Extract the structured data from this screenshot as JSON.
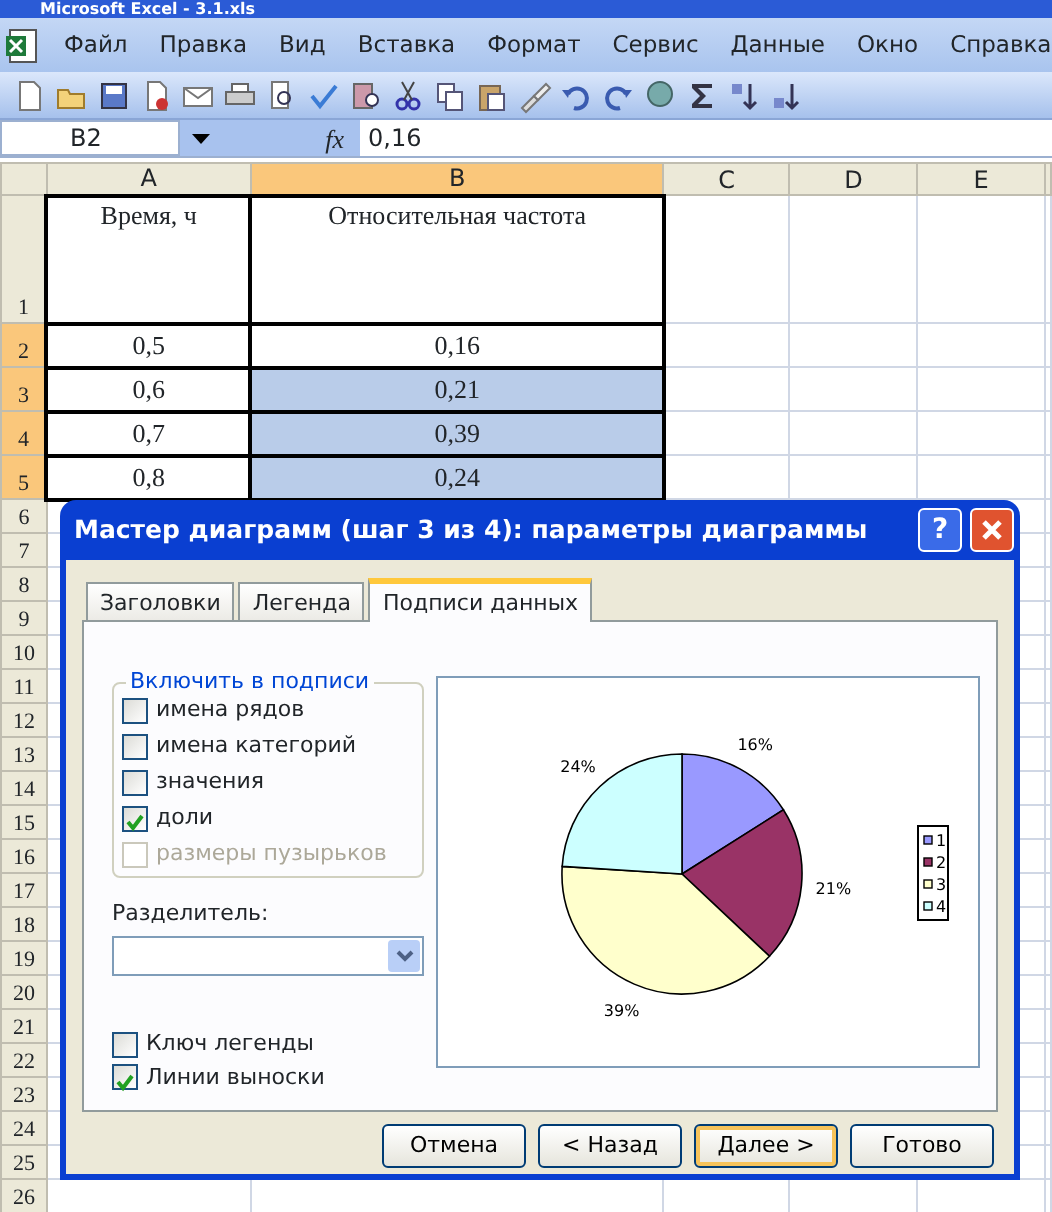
{
  "window": {
    "title": "Microsoft Excel - 3.1.xls"
  },
  "menu": [
    "Файл",
    "Правка",
    "Вид",
    "Вставка",
    "Формат",
    "Сервис",
    "Данные",
    "Окно",
    "Справка"
  ],
  "formula_bar": {
    "name_box": "B2",
    "fx": "fx",
    "value": "0,16"
  },
  "sheet": {
    "columns": [
      {
        "label": "A",
        "selected": false
      },
      {
        "label": "B",
        "selected": true
      },
      {
        "label": "C",
        "selected": false
      },
      {
        "label": "D",
        "selected": false
      },
      {
        "label": "E",
        "selected": false
      }
    ],
    "rows": [
      {
        "label": "1",
        "selected": false,
        "cells": [
          {
            "text": "Время, ч",
            "selected": false
          },
          {
            "text": "Относительная частота",
            "selected": false
          }
        ]
      },
      {
        "label": "2",
        "selected": true,
        "cells": [
          {
            "text": "0,5",
            "selected": false
          },
          {
            "text": "0,16",
            "selected": false
          }
        ]
      },
      {
        "label": "3",
        "selected": true,
        "cells": [
          {
            "text": "0,6",
            "selected": false
          },
          {
            "text": "0,21",
            "selected": true
          }
        ]
      },
      {
        "label": "4",
        "selected": true,
        "cells": [
          {
            "text": "0,7",
            "selected": false
          },
          {
            "text": "0,39",
            "selected": true
          }
        ]
      },
      {
        "label": "5",
        "selected": true,
        "cells": [
          {
            "text": "0,8",
            "selected": false
          },
          {
            "text": "0,24",
            "selected": true
          }
        ]
      },
      {
        "label": "6",
        "selected": false
      },
      {
        "label": "7",
        "selected": false
      },
      {
        "label": "8",
        "selected": false
      },
      {
        "label": "9",
        "selected": false
      },
      {
        "label": "10",
        "selected": false
      },
      {
        "label": "11",
        "selected": false
      },
      {
        "label": "12",
        "selected": false
      },
      {
        "label": "13",
        "selected": false
      },
      {
        "label": "14",
        "selected": false
      },
      {
        "label": "15",
        "selected": false
      },
      {
        "label": "16",
        "selected": false
      },
      {
        "label": "17",
        "selected": false
      },
      {
        "label": "18",
        "selected": false
      },
      {
        "label": "19",
        "selected": false
      },
      {
        "label": "20",
        "selected": false
      },
      {
        "label": "21",
        "selected": false
      },
      {
        "label": "22",
        "selected": false
      },
      {
        "label": "23",
        "selected": false
      },
      {
        "label": "24",
        "selected": false
      },
      {
        "label": "25",
        "selected": false
      },
      {
        "label": "26",
        "selected": false
      }
    ]
  },
  "dialog": {
    "title": "Мастер диаграмм (шаг 3 из 4): параметры диаграммы",
    "help": "?",
    "tabs": [
      {
        "label": "Заголовки",
        "selected": false
      },
      {
        "label": "Легенда",
        "selected": false
      },
      {
        "label": "Подписи данных",
        "selected": true
      }
    ],
    "group": {
      "title": "Включить в подписи",
      "options": [
        {
          "label": "имена рядов",
          "checked": false,
          "disabled": false
        },
        {
          "label": "имена категорий",
          "checked": false,
          "disabled": false
        },
        {
          "label": "значения",
          "checked": false,
          "disabled": false
        },
        {
          "label": "доли",
          "checked": true,
          "disabled": false
        },
        {
          "label": "размеры пузырьков",
          "checked": false,
          "disabled": true
        }
      ]
    },
    "separator": {
      "label": "Разделитель:"
    },
    "options": [
      {
        "label": "Ключ легенды",
        "checked": false
      },
      {
        "label": "Линии выноски",
        "checked": true
      }
    ],
    "preview": {
      "chart_data": {
        "type": "pie",
        "categories": [
          "1",
          "2",
          "3",
          "4"
        ],
        "values": [
          0.16,
          0.21,
          0.39,
          0.24
        ],
        "value_labels": [
          "16%",
          "21%",
          "39%",
          "24%"
        ],
        "legend": "right"
      }
    },
    "buttons": [
      {
        "label": "Отмена",
        "default": false
      },
      {
        "label": "< Назад",
        "default": false
      },
      {
        "label": "Далее >",
        "default": true
      },
      {
        "label": "Готово",
        "default": false
      }
    ]
  }
}
